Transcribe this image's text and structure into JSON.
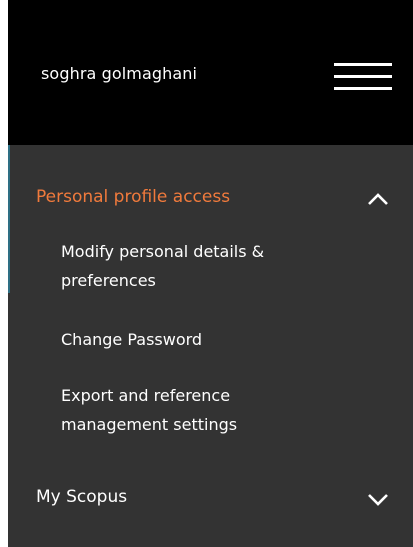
{
  "header": {
    "user_name": "soghra golmaghani",
    "menu_icon": "hamburger-menu-icon"
  },
  "menu": {
    "personal_profile": {
      "label": "Personal profile access",
      "expanded": true,
      "toggle_icon": "chevron-up-icon",
      "items": [
        {
          "label_line1": "Modify personal details &",
          "label_line2": "preferences"
        },
        {
          "label_line1": "Change Password"
        },
        {
          "label_line1": "Export and reference",
          "label_line2": "management settings"
        }
      ]
    },
    "my_scopus": {
      "label": "My Scopus",
      "expanded": false,
      "toggle_icon": "chevron-down-icon"
    }
  },
  "colors": {
    "header_bg": "#000000",
    "menu_bg": "#333333",
    "accent_orange": "#f07a3c",
    "accent_teal": "#2e6f84",
    "text": "#ffffff"
  }
}
